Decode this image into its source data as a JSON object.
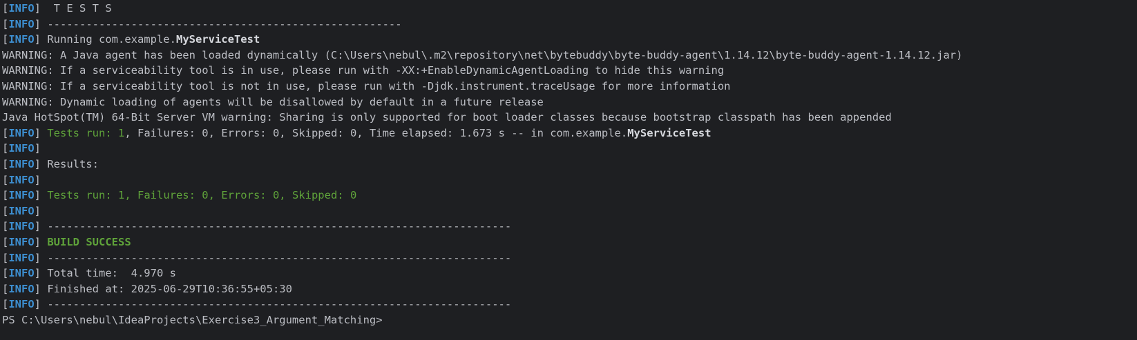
{
  "terminal": {
    "lines": [
      [
        {
          "t": "[",
          "s": "default"
        },
        {
          "t": "INFO",
          "s": "info"
        },
        {
          "t": "]  T E S T S",
          "s": "default"
        }
      ],
      [
        {
          "t": "[",
          "s": "default"
        },
        {
          "t": "INFO",
          "s": "info"
        },
        {
          "t": "] -------------------------------------------------------",
          "s": "default"
        }
      ],
      [
        {
          "t": "[",
          "s": "default"
        },
        {
          "t": "INFO",
          "s": "info"
        },
        {
          "t": "] Running com.example.",
          "s": "default"
        },
        {
          "t": "MyServiceTest",
          "s": "bold"
        }
      ],
      [
        {
          "t": "WARNING: A Java agent has been loaded dynamically (C:\\Users\\nebul\\.m2\\repository\\net\\bytebuddy\\byte-buddy-agent\\1.14.12\\byte-buddy-agent-1.14.12.jar)",
          "s": "default"
        }
      ],
      [
        {
          "t": "WARNING: If a serviceability tool is in use, please run with -XX:+EnableDynamicAgentLoading to hide this warning",
          "s": "default"
        }
      ],
      [
        {
          "t": "WARNING: If a serviceability tool is not in use, please run with -Djdk.instrument.traceUsage for more information",
          "s": "default"
        }
      ],
      [
        {
          "t": "WARNING: Dynamic loading of agents will be disallowed by default in a future release",
          "s": "default"
        }
      ],
      [
        {
          "t": "Java HotSpot(TM) 64-Bit Server VM warning: Sharing is only supported for boot loader classes because bootstrap classpath has been appended",
          "s": "default"
        }
      ],
      [
        {
          "t": "[",
          "s": "default"
        },
        {
          "t": "INFO",
          "s": "info"
        },
        {
          "t": "] ",
          "s": "default"
        },
        {
          "t": "Tests run: 1",
          "s": "green"
        },
        {
          "t": ", Failures: 0, Errors: 0, Skipped: 0, Time elapsed: 1.673 s -- in com.example.",
          "s": "default"
        },
        {
          "t": "MyServiceTest",
          "s": "bold"
        }
      ],
      [
        {
          "t": "[",
          "s": "default"
        },
        {
          "t": "INFO",
          "s": "info"
        },
        {
          "t": "]",
          "s": "default"
        }
      ],
      [
        {
          "t": "[",
          "s": "default"
        },
        {
          "t": "INFO",
          "s": "info"
        },
        {
          "t": "] Results:",
          "s": "default"
        }
      ],
      [
        {
          "t": "[",
          "s": "default"
        },
        {
          "t": "INFO",
          "s": "info"
        },
        {
          "t": "]",
          "s": "default"
        }
      ],
      [
        {
          "t": "[",
          "s": "default"
        },
        {
          "t": "INFO",
          "s": "info"
        },
        {
          "t": "] ",
          "s": "default"
        },
        {
          "t": "Tests run: 1, Failures: 0, Errors: 0, Skipped: 0",
          "s": "green"
        }
      ],
      [
        {
          "t": "[",
          "s": "default"
        },
        {
          "t": "INFO",
          "s": "info"
        },
        {
          "t": "]",
          "s": "default"
        }
      ],
      [
        {
          "t": "[",
          "s": "default"
        },
        {
          "t": "INFO",
          "s": "info"
        },
        {
          "t": "] ------------------------------------------------------------------------",
          "s": "default"
        }
      ],
      [
        {
          "t": "[",
          "s": "default"
        },
        {
          "t": "INFO",
          "s": "info"
        },
        {
          "t": "] ",
          "s": "default"
        },
        {
          "t": "BUILD SUCCESS",
          "s": "green-bold"
        }
      ],
      [
        {
          "t": "[",
          "s": "default"
        },
        {
          "t": "INFO",
          "s": "info"
        },
        {
          "t": "] ------------------------------------------------------------------------",
          "s": "default"
        }
      ],
      [
        {
          "t": "[",
          "s": "default"
        },
        {
          "t": "INFO",
          "s": "info"
        },
        {
          "t": "] Total time:  4.970 s",
          "s": "default"
        }
      ],
      [
        {
          "t": "[",
          "s": "default"
        },
        {
          "t": "INFO",
          "s": "info"
        },
        {
          "t": "] Finished at: 2025-06-29T10:36:55+05:30",
          "s": "default"
        }
      ],
      [
        {
          "t": "[",
          "s": "default"
        },
        {
          "t": "INFO",
          "s": "info"
        },
        {
          "t": "] ------------------------------------------------------------------------",
          "s": "default"
        }
      ],
      [
        {
          "t": "PS C:\\Users\\nebul\\IdeaProjects\\Exercise3_Argument_Matching>",
          "s": "prompt"
        }
      ]
    ]
  },
  "colors": {
    "background": "#1e1f22",
    "text": "#bcbec4",
    "info": "#3d8fd1",
    "success": "#5fa33a"
  }
}
